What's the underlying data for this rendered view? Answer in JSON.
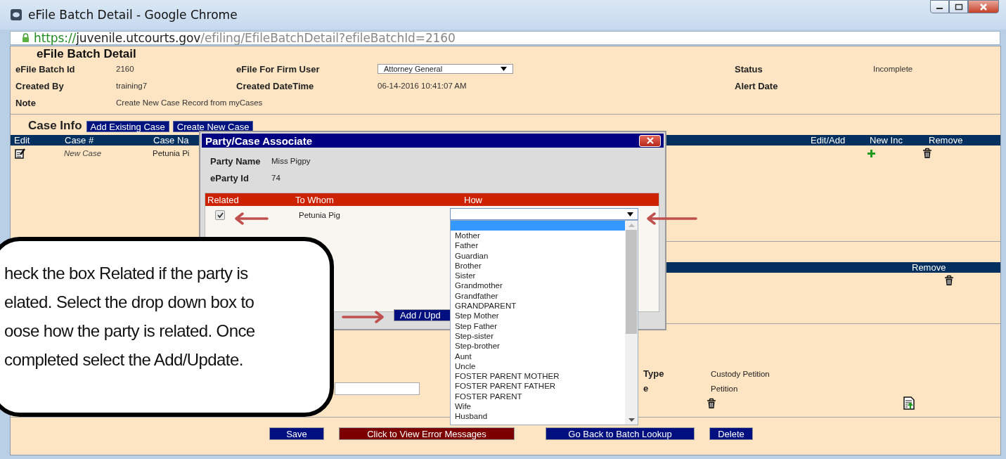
{
  "window": {
    "title": "eFile Batch Detail - Google Chrome"
  },
  "address_bar": {
    "scheme": "https://",
    "host": "juvenile.utcourts.gov",
    "path": "/efiling/EfileBatchDetail?efileBatchId=2160"
  },
  "batch": {
    "heading": "eFile Batch Detail",
    "rows": [
      [
        {
          "kind": "label",
          "text": "eFile Batch Id"
        },
        {
          "kind": "value",
          "text": "2160"
        },
        {
          "kind": "label",
          "text": "eFile For Firm User"
        },
        {
          "kind": "select",
          "text": "Attorney General"
        },
        {
          "kind": "label",
          "text": "Status"
        },
        {
          "kind": "value",
          "text": "Incomplete"
        }
      ],
      [
        {
          "kind": "label",
          "text": "Created By"
        },
        {
          "kind": "value",
          "text": "training7"
        },
        {
          "kind": "label",
          "text": "Created DateTime"
        },
        {
          "kind": "value",
          "text": "06-14-2016 10:41:07 AM"
        },
        {
          "kind": "label",
          "text": "Alert Date"
        }
      ],
      [
        {
          "kind": "label",
          "text": "Note"
        },
        {
          "kind": "value",
          "text": "Create New Case Record from myCases"
        }
      ]
    ]
  },
  "case_info": {
    "title": "Case Info",
    "buttons": [
      "Add Existing Case",
      "Create New Case"
    ],
    "columns": [
      "Edit",
      "Case #",
      "Case Na"
    ],
    "right_columns": [
      "Edit/Add",
      "New Inc",
      "Remove"
    ],
    "rows": [
      {
        "case_number": "New Case",
        "case_name": "Petunia Pi"
      }
    ]
  },
  "second_table": {
    "columns": [
      "Remove"
    ]
  },
  "details": [
    {
      "label": "Type",
      "value": "Custody Petition"
    },
    {
      "label": "e",
      "value": "Petition"
    }
  ],
  "footer_buttons": [
    {
      "label": "Save",
      "kind": "primary"
    },
    {
      "label": "Click to View Error Messages",
      "kind": "danger"
    },
    {
      "label": "Go Back to Batch Lookup",
      "kind": "primary"
    },
    {
      "label": "Delete",
      "kind": "primary"
    }
  ],
  "dialog": {
    "title": "Party/Case Associate",
    "fields": [
      {
        "label": "Party Name",
        "value": "Miss Pigpy"
      },
      {
        "label": "eParty Id",
        "value": "74"
      }
    ],
    "columns": [
      "Related",
      "To Whom",
      "How"
    ],
    "rows": [
      {
        "related": true,
        "to_whom": "Petunia Pig"
      }
    ],
    "submit": "Add / Upd",
    "how_dropdown": {
      "expanded": true,
      "blank_option_highlighted": true,
      "options": [
        "Mother",
        "Father",
        "Guardian",
        "Brother",
        "Sister",
        "Grandmother",
        "Grandfather",
        "GRANDPARENT",
        "Step Mother",
        "Step Father",
        "Step-sister",
        "Step-brother",
        "Aunt",
        "Uncle",
        "FOSTER PARENT MOTHER",
        "FOSTER PARENT FATHER",
        "FOSTER PARENT",
        "Wife",
        "Husband"
      ]
    }
  },
  "callout": {
    "lines": [
      "heck the box Related if the party is",
      "elated.  Select the drop down box to",
      "oose how the party is related.  Once",
      "completed select the Add/Update."
    ]
  }
}
